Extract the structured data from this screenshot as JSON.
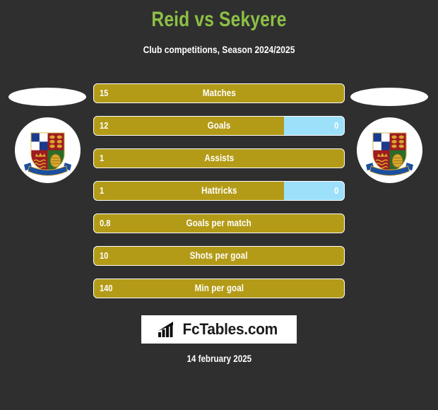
{
  "header": {
    "title": "Reid vs Sekyere",
    "subtitle": "Club competitions, Season 2024/2025",
    "title_color": "#8dc045"
  },
  "colors": {
    "background": "#2f2f2f",
    "home_bar": "#b39b17",
    "away_bar": "#9de0fa",
    "text": "#ffffff"
  },
  "players": {
    "home": {
      "crest_name": "club-crest",
      "photo_placeholder": "player-photo"
    },
    "away": {
      "crest_name": "club-crest",
      "photo_placeholder": "player-photo"
    }
  },
  "stats": [
    {
      "label": "Matches",
      "home": "15",
      "away": "",
      "home_pct": 100
    },
    {
      "label": "Goals",
      "home": "12",
      "away": "0",
      "home_pct": 76
    },
    {
      "label": "Assists",
      "home": "1",
      "away": "",
      "home_pct": 100
    },
    {
      "label": "Hattricks",
      "home": "1",
      "away": "0",
      "home_pct": 76
    },
    {
      "label": "Goals per match",
      "home": "0.8",
      "away": "",
      "home_pct": 100
    },
    {
      "label": "Shots per goal",
      "home": "10",
      "away": "",
      "home_pct": 100
    },
    {
      "label": "Min per goal",
      "home": "140",
      "away": "",
      "home_pct": 100
    }
  ],
  "footer": {
    "logo_text": "FcTables.com",
    "logo_icon": "bar-chart-icon",
    "date": "14 february 2025"
  }
}
